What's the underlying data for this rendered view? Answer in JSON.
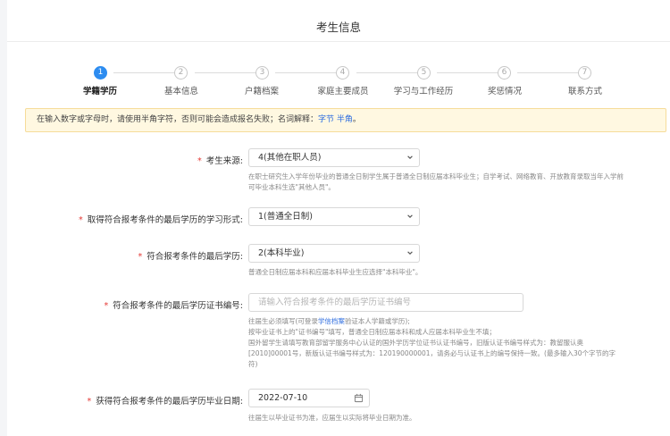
{
  "page_title": "考生信息",
  "steps": [
    {
      "num": "1",
      "label": "学籍学历",
      "active": true
    },
    {
      "num": "2",
      "label": "基本信息",
      "active": false
    },
    {
      "num": "3",
      "label": "户籍档案",
      "active": false
    },
    {
      "num": "4",
      "label": "家庭主要成员",
      "active": false
    },
    {
      "num": "5",
      "label": "学习与工作经历",
      "active": false
    },
    {
      "num": "6",
      "label": "奖惩情况",
      "active": false
    },
    {
      "num": "7",
      "label": "联系方式",
      "active": false
    }
  ],
  "notice": {
    "text": "在输入数字或字母时，请使用半角字符，否则可能会造成报名失败；名词解释：",
    "link1": "字节",
    "link2": "半角",
    "end": "。"
  },
  "form": {
    "source": {
      "label": "考生来源:",
      "value": "4(其他在职人员)",
      "hint": "在职士研究生入学年份毕业的普通全日制学生属于普通全日制应届本科毕业生；自学考试、网络教育、开放教育录取当年入学前可毕业本科生选\"其他人员\"。"
    },
    "study_form": {
      "label": "取得符合报考条件的最后学历的学习形式:",
      "value": "1(普通全日制)"
    },
    "last_degree": {
      "label": "符合报考条件的最后学历:",
      "value": "2(本科毕业)",
      "hint": "普通全日制应届本科和应届本科毕业生应选择\"本科毕业\"。"
    },
    "cert_no": {
      "label": "符合报考条件的最后学历证书编号:",
      "placeholder": "请输入符合报考条件的最后学历证书编号",
      "hint_line1_a": "往届生必须填写(可登录",
      "hint_line1_link": "学信档案",
      "hint_line1_b": "验证本人学籍或学历);",
      "hint_line2": "按毕业证书上的\"证书编号\"填写，普通全日制应届本科和成人应届本科毕业生不填；",
      "hint_line3": "国外留学生请填写教育部留学服务中心认证的国外学历学位证书认证书编号，旧版认证书编号样式为：教留服认奥[2010]00001号，新版认证书编号样式为：120190000001，请务必与认证书上的编号保持一致。(最多输入30个字节的字符)"
    },
    "grad_date": {
      "label": "获得符合报考条件的最后学历毕业日期:",
      "value": "2022-07-10",
      "hint": "往届生以毕业证书为准，应届生以实际将毕业日期为准。"
    }
  }
}
